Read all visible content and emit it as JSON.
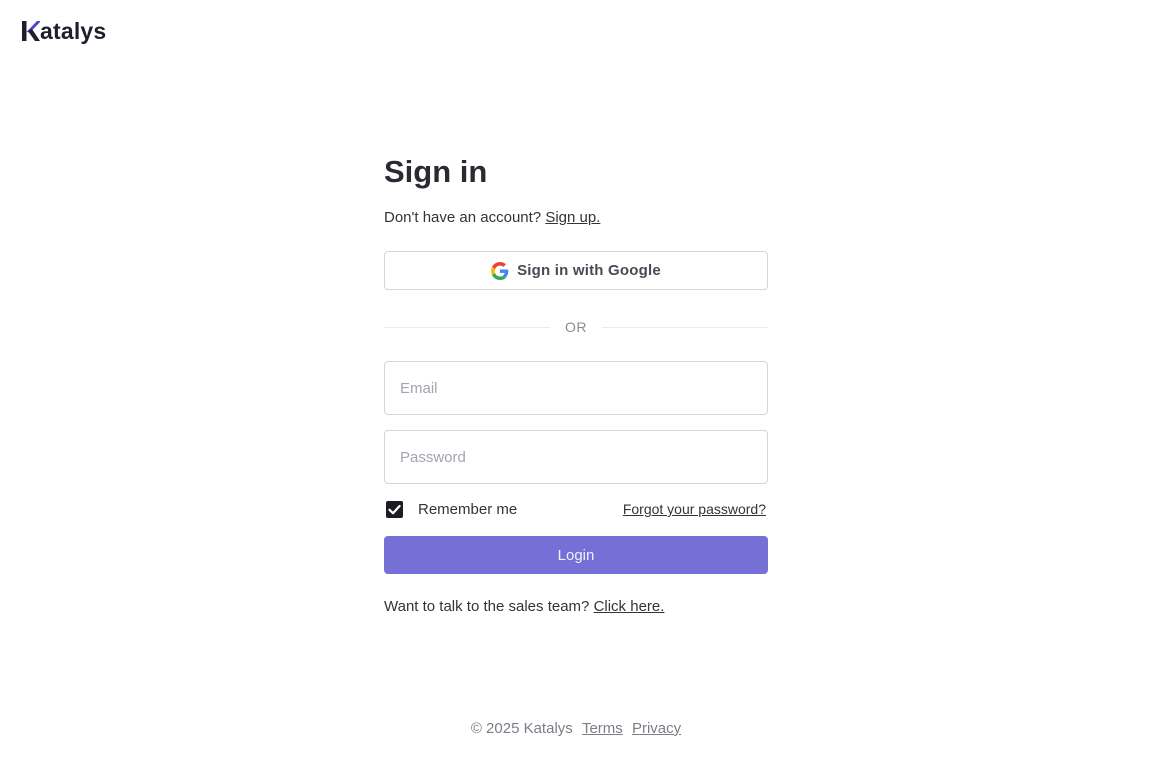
{
  "brand": {
    "name": "atalys",
    "logo_icon": "katalys-k-logo",
    "accent_color": "#4a45c8"
  },
  "signin": {
    "title": "Sign in",
    "no_account_text": "Don't have an account?",
    "signup_link": "Sign up.",
    "google_button": "Sign in with Google",
    "or_divider": "OR",
    "email_placeholder": "Email",
    "email_value": "",
    "password_placeholder": "Password",
    "password_value": "",
    "remember_label": "Remember me",
    "remember_checked": true,
    "forgot_link": "Forgot your password?",
    "login_button": "Login",
    "login_color": "#7670d6",
    "sales_text": "Want to talk to the sales team?",
    "sales_link": "Click here."
  },
  "footer": {
    "copyright": "© 2025 Katalys",
    "terms": "Terms",
    "privacy": "Privacy"
  }
}
